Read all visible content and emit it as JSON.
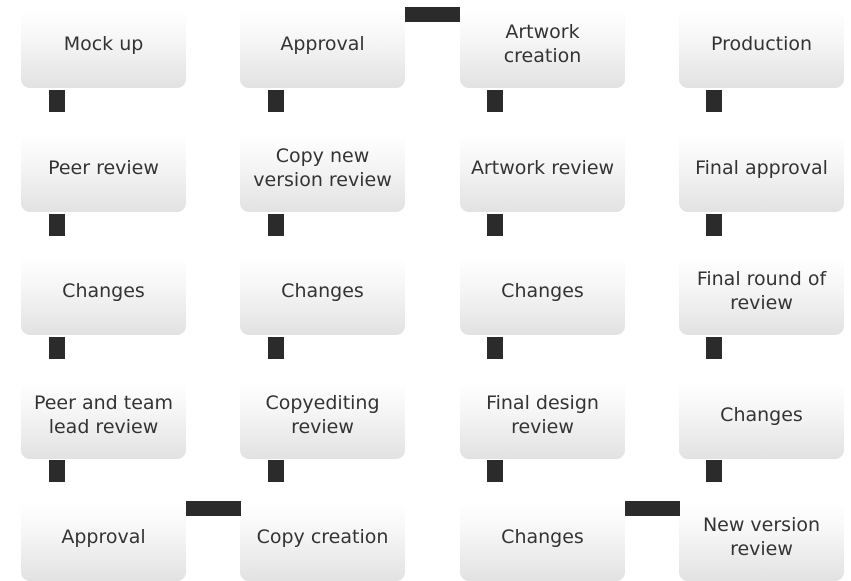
{
  "nodes": {
    "mock_up": "Mock up",
    "approval_1": "Approval",
    "artwork_creation": "Artwork\ncreation",
    "production": "Production",
    "peer_review": "Peer review",
    "copy_new_version_review": "Copy new\nversion review",
    "artwork_review": "Artwork review",
    "final_approval": "Final approval",
    "changes_1": "Changes",
    "changes_2": "Changes",
    "changes_3": "Changes",
    "final_round_of_review": "Final round of\nreview",
    "peer_and_team_lead_review": "Peer and team\nlead review",
    "copyediting_review": "Copyediting\nreview",
    "final_design_review": "Final design\nreview",
    "changes_4": "Changes",
    "approval_2": "Approval",
    "copy_creation": "Copy creation",
    "changes_5": "Changes",
    "new_version_review": "New version\nreview"
  },
  "colors": {
    "connector": "#2b2b2b",
    "text": "#333333",
    "box_top": "#ffffff",
    "box_bottom": "#e2e2e2"
  }
}
